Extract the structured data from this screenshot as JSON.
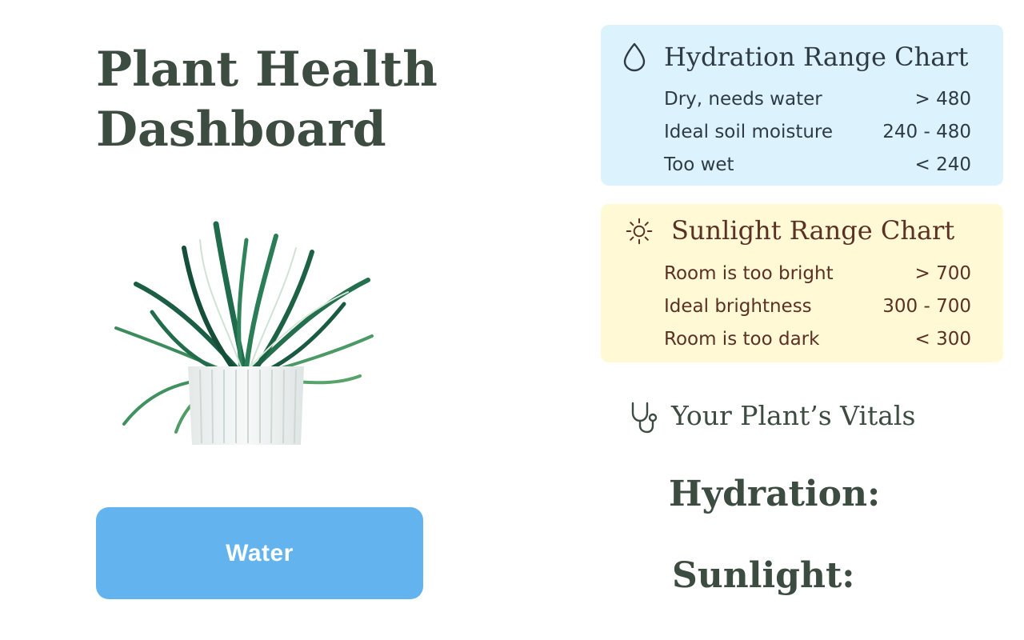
{
  "page": {
    "title": "Plant Health Dashboard"
  },
  "plant_image": {
    "description_icon": "potted-plant-illustration"
  },
  "actions": {
    "water_label": "Water"
  },
  "hydration_chart": {
    "icon": "water-drop-icon",
    "title": "Hydration Range Chart",
    "rows": [
      {
        "label": "Dry, needs water",
        "range": "> 480"
      },
      {
        "label": "Ideal soil moisture",
        "range": "240 - 480"
      },
      {
        "label": "Too wet",
        "range": "< 240"
      }
    ]
  },
  "sunlight_chart": {
    "icon": "sun-icon",
    "title": "Sunlight Range Chart",
    "rows": [
      {
        "label": "Room is too bright",
        "range": "> 700"
      },
      {
        "label": "Ideal brightness",
        "range": "300 - 700"
      },
      {
        "label": "Room is too dark",
        "range": "< 300"
      }
    ]
  },
  "vitals": {
    "icon": "stethoscope-icon",
    "title": "Your Plant’s Vitals",
    "hydration_label": "Hydration:",
    "sunlight_label": "Sunlight:"
  },
  "colors": {
    "water_button": "#63b3ef",
    "hydration_card": "#dcf3fd",
    "sunlight_card": "#fff9d6",
    "heading_text": "#3d4c40",
    "sunlight_text": "#5a3122"
  }
}
